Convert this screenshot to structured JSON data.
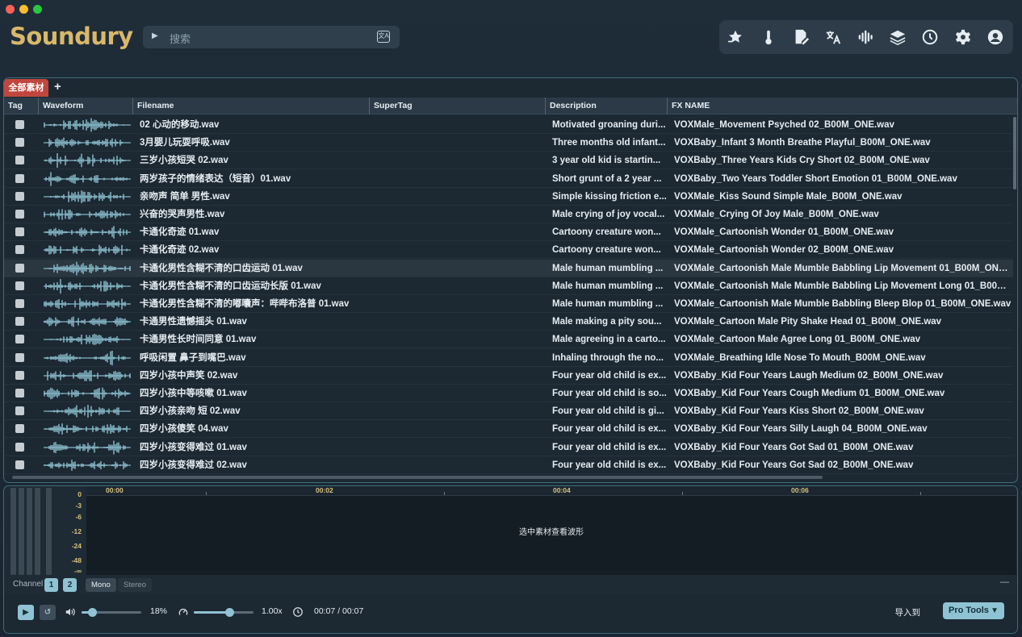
{
  "app": {
    "name": "Soundury"
  },
  "search": {
    "placeholder": "搜索"
  },
  "toolbar_icons": [
    "favorites-icon",
    "thermometer-icon",
    "edit-document-icon",
    "translate-icon",
    "waveform-icon",
    "layers-icon",
    "history-icon",
    "gear-icon",
    "user-icon"
  ],
  "tabs": {
    "active": "全部素材",
    "add": "+"
  },
  "columns": {
    "tag": "Tag",
    "waveform": "Waveform",
    "filename": "Filename",
    "supertag": "SuperTag",
    "description": "Description",
    "fxname": "FX NAME"
  },
  "rows": [
    {
      "filename": "02 心动的移动.wav",
      "description": "Motivated groaning duri...",
      "fx": "VOXMale_Movement Psyched 02_B00M_ONE.wav"
    },
    {
      "filename": "3月婴儿玩耍呼吸.wav",
      "description": "Three months old infant...",
      "fx": "VOXBaby_Infant 3 Month Breathe Playful_B00M_ONE.wav"
    },
    {
      "filename": "三岁小孩短哭 02.wav",
      "description": "3 year old kid is startin...",
      "fx": "VOXBaby_Three Years Kids Cry Short 02_B00M_ONE.wav"
    },
    {
      "filename": "两岁孩子的情绪表达（短音）01.wav",
      "description": "Short grunt of a 2 year ...",
      "fx": "VOXBaby_Two Years Toddler Short Emotion 01_B00M_ONE.wav"
    },
    {
      "filename": "亲吻声 简单 男性.wav",
      "description": "Simple kissing friction e...",
      "fx": "VOXMale_Kiss Sound Simple Male_B00M_ONE.wav"
    },
    {
      "filename": "兴奋的哭声男性.wav",
      "description": "Male crying of joy vocal...",
      "fx": "VOXMale_Crying Of Joy Male_B00M_ONE.wav"
    },
    {
      "filename": "卡通化奇迹 01.wav",
      "description": "Cartoony creature won...",
      "fx": "VOXMale_Cartoonish Wonder 01_B00M_ONE.wav"
    },
    {
      "filename": "卡通化奇迹 02.wav",
      "description": "Cartoony creature won...",
      "fx": "VOXMale_Cartoonish Wonder 02_B00M_ONE.wav"
    },
    {
      "filename": "卡通化男性含糊不清的口齿运动 01.wav",
      "description": "Male human mumbling ...",
      "fx": "VOXMale_Cartoonish Male Mumble Babbling Lip Movement 01_B00M_ONE...."
    },
    {
      "filename": "卡通化男性含糊不清的口齿运动长版 01.wav",
      "description": "Male human mumbling ...",
      "fx": "VOXMale_Cartoonish Male Mumble Babbling Lip Movement Long 01_B00M_..."
    },
    {
      "filename": "卡通化男性含糊不清的嘟囔声：哔哔布洛普 01.wav",
      "description": "Male human mumbling ...",
      "fx": "VOXMale_Cartoonish Male Mumble Babbling Bleep Blop 01_B00M_ONE.wav"
    },
    {
      "filename": "卡通男性遗憾摇头 01.wav",
      "description": "Male making a pity sou...",
      "fx": "VOXMale_Cartoon Male Pity Shake Head 01_B00M_ONE.wav"
    },
    {
      "filename": "卡通男性长时间同意 01.wav",
      "description": "Male agreeing in a carto...",
      "fx": "VOXMale_Cartoon Male Agree Long 01_B00M_ONE.wav"
    },
    {
      "filename": "呼吸闲置 鼻子到嘴巴.wav",
      "description": "Inhaling through the no...",
      "fx": "VOXMale_Breathing Idle Nose To Mouth_B00M_ONE.wav"
    },
    {
      "filename": "四岁小孩中声笑 02.wav",
      "description": "Four year old child is ex...",
      "fx": "VOXBaby_Kid Four Years Laugh Medium 02_B00M_ONE.wav"
    },
    {
      "filename": "四岁小孩中等咳嗽 01.wav",
      "description": "Four year old child is so...",
      "fx": "VOXBaby_Kid Four Years Cough Medium 01_B00M_ONE.wav"
    },
    {
      "filename": "四岁小孩亲吻 短 02.wav",
      "description": "Four year old child is gi...",
      "fx": "VOXBaby_Kid Four Years Kiss Short 02_B00M_ONE.wav"
    },
    {
      "filename": "四岁小孩傻笑 04.wav",
      "description": "Four year old child is ex...",
      "fx": "VOXBaby_Kid Four Years Silly Laugh 04_B00M_ONE.wav"
    },
    {
      "filename": "四岁小孩变得难过 01.wav",
      "description": "Four year old child is ex...",
      "fx": "VOXBaby_Kid Four Years Got Sad 01_B00M_ONE.wav"
    },
    {
      "filename": "四岁小孩变得难过 02.wav",
      "description": "Four year old child is ex...",
      "fx": "VOXBaby_Kid Four Years Got Sad 02_B00M_ONE.wav"
    }
  ],
  "selected_row": 8,
  "waveform_panel": {
    "db_scale": [
      "0",
      "-3",
      "-6",
      "-12",
      "-24",
      "-48",
      "-∞"
    ],
    "ruler": [
      "00:00",
      "00:02",
      "00:04",
      "00:06"
    ],
    "empty_message": "选中素材查看波形",
    "channel_label": "Channel",
    "channels": [
      "1",
      "2"
    ],
    "mode_mono": "Mono",
    "mode_stereo": "Stereo",
    "collapse": "—"
  },
  "transport": {
    "volume_percent": "18%",
    "volume_value": 0.18,
    "speed": "1.00x",
    "speed_position": 0.6,
    "time": "00:07 / 00:07",
    "export_label": "导入到",
    "export_target": "Pro Tools"
  },
  "colors": {
    "accent": "#8fc3d3",
    "tab_active": "#c0473f",
    "logo": "#d9b86b",
    "panel_border": "#3d6e7c"
  }
}
